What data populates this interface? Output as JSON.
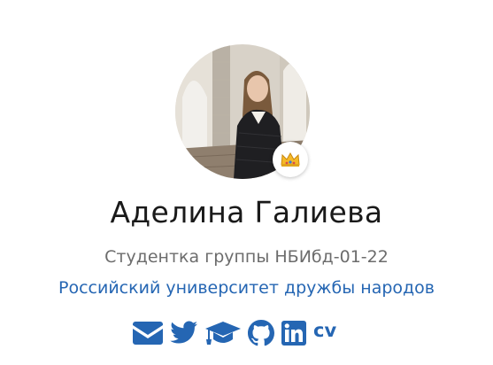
{
  "profile": {
    "name": "Аделина Галиева",
    "subtitle": "Студентка группы НБИбд-01-22",
    "affiliation": "Российский университет дружбы народов",
    "avatar_alt": "profile photo",
    "badge_emoji": "👑"
  },
  "socials": [
    {
      "icon": "envelope-icon"
    },
    {
      "icon": "twitter-icon"
    },
    {
      "icon": "graduation-cap-icon"
    },
    {
      "icon": "github-icon"
    },
    {
      "icon": "linkedin-icon"
    },
    {
      "icon": "cv-icon",
      "label": "cv"
    }
  ],
  "colors": {
    "accent": "#2566b3",
    "name": "#1a1a1a",
    "subtitle": "#6c6c6c"
  }
}
